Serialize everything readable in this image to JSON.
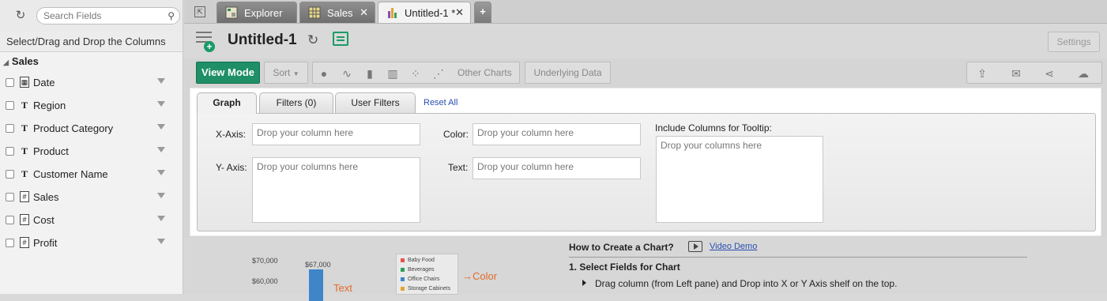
{
  "left": {
    "search_placeholder": "Search Fields",
    "header": "Select/Drag and Drop the Columns",
    "group": "Sales",
    "fields": [
      {
        "label": "Date",
        "type_icon": "calendar-icon"
      },
      {
        "label": "Region",
        "type_icon": "T"
      },
      {
        "label": "Product Category",
        "type_icon": "T"
      },
      {
        "label": "Product",
        "type_icon": "T"
      },
      {
        "label": "Customer Name",
        "type_icon": "T"
      },
      {
        "label": "Sales",
        "type_icon": "measure-icon"
      },
      {
        "label": "Cost",
        "type_icon": "measure-icon"
      },
      {
        "label": "Profit",
        "type_icon": "measure-icon"
      }
    ]
  },
  "tabs": [
    {
      "label": "Explorer",
      "icon": "explorer-icon"
    },
    {
      "label": "Sales",
      "icon": "table-icon"
    },
    {
      "label": "Untitled-1 *",
      "icon": "chart-icon"
    }
  ],
  "report": {
    "title": "Untitled-1",
    "settings": "Settings"
  },
  "toolbar": {
    "view_mode": "View Mode",
    "sort": "Sort",
    "other_charts": "Other Charts",
    "underlying_data": "Underlying Data"
  },
  "panel": {
    "tab_graph": "Graph",
    "tab_filters": "Filters  (0)",
    "tab_user_filters": "User Filters",
    "reset_all": "Reset All",
    "xaxis_label": "X-Axis:",
    "xaxis_placeholder": "Drop your column here",
    "yaxis_label": "Y- Axis:",
    "yaxis_placeholder": "Drop your columns here",
    "color_label": "Color:",
    "color_placeholder": "Drop your column here",
    "text_label": "Text:",
    "text_placeholder": "Drop your column here",
    "tooltip_label": "Include Columns for Tooltip:",
    "tooltip_placeholder": "Drop your columns here"
  },
  "help": {
    "y_ticks": [
      "$70,000",
      "$60,000"
    ],
    "bar_label": "$67,000",
    "legend": [
      {
        "label": "Baby Food",
        "color": "#e5534b"
      },
      {
        "label": "Beverages",
        "color": "#2e9e5b"
      },
      {
        "label": "Office Chairs",
        "color": "#3e86c8"
      },
      {
        "label": "Storage Cabinets",
        "color": "#e3a52f"
      }
    ],
    "text_annotation": "Text",
    "color_annotation": "→Color",
    "how_to": "How to Create a Chart?",
    "video_demo": "Video Demo",
    "step1": "1. Select Fields for Chart",
    "step1_desc": "Drag column (from Left pane) and Drop into X or Y Axis shelf on the top."
  }
}
